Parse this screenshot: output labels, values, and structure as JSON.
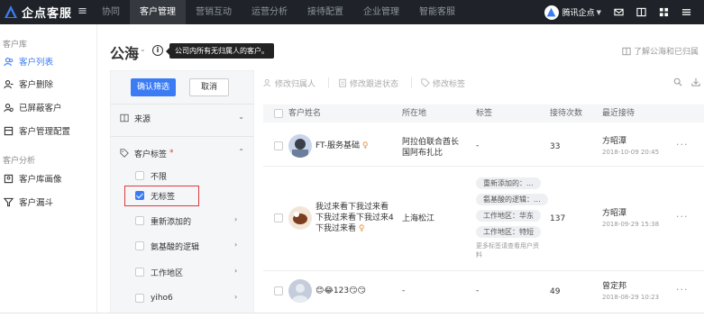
{
  "brand": {
    "name": "企点客服"
  },
  "nav": {
    "items": [
      "协同",
      "客户管理",
      "营销互动",
      "运营分析",
      "接待配置",
      "企业管理",
      "智能客服"
    ],
    "active_index": 1
  },
  "user": {
    "name": "腾讯企点"
  },
  "leftnav": {
    "section1": "客户库",
    "items1": [
      "客户列表",
      "客户删除",
      "已屏蔽客户",
      "客户管理配置"
    ],
    "section2": "客户分析",
    "items2": [
      "客户库画像",
      "客户漏斗"
    ]
  },
  "page": {
    "title": "公海",
    "tooltip": "公司内所有无归属人的客户。",
    "learn_link": "了解公海和已归属"
  },
  "filter": {
    "confirm": "确认筛选",
    "cancel": "取消",
    "source": "来源",
    "tag_label": "客户标签",
    "required_mark": "*",
    "options": [
      "不限",
      "无标签",
      "重新添加的",
      "氨基酸的逻辑",
      "工作地区",
      "yiho6"
    ],
    "checked_index": 1
  },
  "toolbar": {
    "buttons": [
      "修改归属人",
      "修改跟进状态",
      "修改标签"
    ]
  },
  "table": {
    "headers": [
      "客户姓名",
      "所在地",
      "标签",
      "接待次数",
      "最近接待"
    ],
    "rows": [
      {
        "name": "FT-服务基础",
        "location": "阿拉伯联合酋长国阿布扎比",
        "tags": [
          "-"
        ],
        "count": "33",
        "agent": "方昭潭",
        "time": "2018-10-09 20:45"
      },
      {
        "name": "我过来看下我过来看下我过来看下我过来4下我过来看",
        "location": "上海松江",
        "tags": [
          "重新添加的：...",
          "氨基酸的逻辑：...",
          "工作地区：华东",
          "工作地区：特短"
        ],
        "more": "更多标签请查看用户资料",
        "count": "137",
        "agent": "方昭潭",
        "time": "2018-09-29 15:38"
      },
      {
        "name": "😊😂123😏😏",
        "location": "-",
        "tags": [
          "-"
        ],
        "count": "49",
        "agent": "曾定邦",
        "time": "2018-08-29 10:23"
      }
    ]
  },
  "colors": {
    "accent": "#3b7cf5",
    "topbar": "#1f2329",
    "highlight": "#e0383e"
  }
}
